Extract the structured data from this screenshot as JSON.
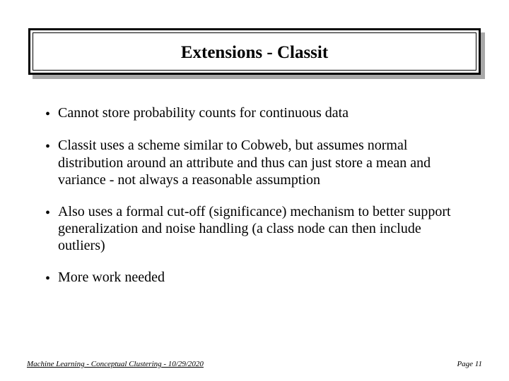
{
  "title": "Extensions - Classit",
  "bullets": [
    "Cannot store probability counts for continuous data",
    "Classit uses a scheme similar to Cobweb, but assumes normal distribution around an attribute and thus can just store a mean and variance - not always a reasonable assumption",
    "Also uses a formal cut-off (significance) mechanism to better support generalization and noise handling (a class node can then include outliers)",
    "More work needed"
  ],
  "footer": {
    "left": "Machine Learning -  Conceptual Clustering - 10/29/2020",
    "right": "Page 11"
  }
}
